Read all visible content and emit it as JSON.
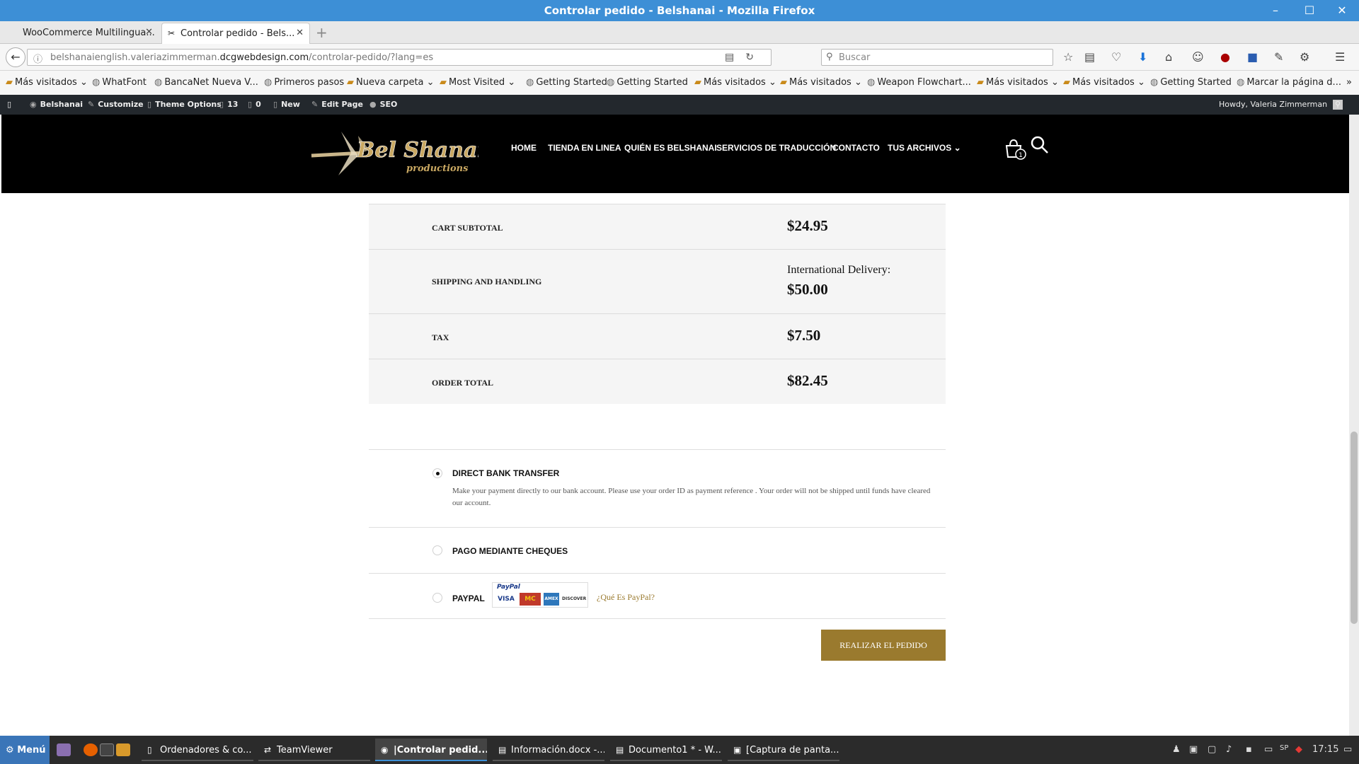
{
  "window": {
    "title": "Controlar pedido - Belshanai - Mozilla Firefox",
    "controls": [
      "–",
      "☐",
      "✕"
    ]
  },
  "tabs": [
    {
      "label": "WooCommerce Multilingua...",
      "active": false
    },
    {
      "label": "Controlar pedido - Bels...",
      "active": true
    }
  ],
  "url": {
    "prefix": "belshanaienglish.valeriazimmerman.",
    "host": "dcgwebdesign.com",
    "path": "/controlar-pedido/?lang=es"
  },
  "search": {
    "placeholder": "Buscar"
  },
  "bookmarks": [
    {
      "label": "Más visitados",
      "icon": "folder-icon",
      "dropdown": true
    },
    {
      "label": "WhatFont",
      "icon": "globe-icon",
      "dropdown": false
    },
    {
      "label": "BancaNet Nueva V...",
      "icon": "globe-icon",
      "dropdown": false
    },
    {
      "label": "Primeros pasos",
      "icon": "globe-icon",
      "dropdown": false
    },
    {
      "label": "Nueva carpeta",
      "icon": "folder-icon",
      "dropdown": true
    },
    {
      "label": "Most Visited",
      "icon": "folder-icon",
      "dropdown": true
    },
    {
      "label": "Getting Started",
      "icon": "globe-icon",
      "dropdown": false
    },
    {
      "label": "Getting Started",
      "icon": "globe-icon",
      "dropdown": false
    },
    {
      "label": "Más visitados",
      "icon": "folder-icon",
      "dropdown": true
    },
    {
      "label": "Más visitados",
      "icon": "folder-icon",
      "dropdown": true
    },
    {
      "label": "Weapon Flowchart...",
      "icon": "globe-icon",
      "dropdown": false
    },
    {
      "label": "Más visitados",
      "icon": "folder-icon",
      "dropdown": true
    },
    {
      "label": "Más visitados",
      "icon": "folder-icon",
      "dropdown": true
    },
    {
      "label": "Getting Started",
      "icon": "globe-icon",
      "dropdown": false
    },
    {
      "label": "Marcar la página d...",
      "icon": "globe-icon",
      "dropdown": false
    }
  ],
  "admin_bar": {
    "site": "Belshanai",
    "customize": "Customize",
    "theme_options": "Theme Options",
    "updates": "13",
    "comments": "0",
    "new": "New",
    "edit_page": "Edit Page",
    "seo": "SEO",
    "howdy": "Howdy, Valeria Zimmerman"
  },
  "site": {
    "logo_text": "Bel Shanai",
    "logo_sub": "productions",
    "menu": [
      "HOME",
      "TIENDA EN LINEA",
      "QUIÉN ES BELSHANAI",
      "SERVICIOS DE TRADUCCIÓN",
      "CONTACTO",
      "TUS ARCHIVOS"
    ],
    "menu_dropdown": "⌄",
    "cart_count": "1"
  },
  "totals": {
    "subtotal_label": "CART SUBTOTAL",
    "subtotal": "$24.95",
    "shipping_label": "SHIPPING AND HANDLING",
    "shipping_method": "International Delivery:",
    "shipping": "$50.00",
    "tax_label": "TAX",
    "tax": "$7.50",
    "total_label": "ORDER TOTAL",
    "total": "$82.45"
  },
  "payment": {
    "bacs_label": "DIRECT BANK TRANSFER",
    "bacs_desc": "Make your payment directly to our bank account. Please use your order ID as payment reference . Your order will not be shipped until funds have cleared our account.",
    "cheque_label": "PAGO MEDIANTE CHEQUES",
    "paypal_label": "PAYPAL",
    "paypal_brand": "PayPal",
    "cards": [
      "VISA",
      "MC",
      "AMEX",
      "DISCOVER"
    ],
    "what_is_paypal": "¿Qué Es PayPal?",
    "selected": "bacs"
  },
  "place_order": "REALIZAR EL PEDIDO",
  "taskbar": {
    "start": "Menú",
    "tasks": [
      {
        "label": "Ordenadores & co...",
        "active": false
      },
      {
        "label": "TeamViewer",
        "active": false
      },
      {
        "label": "|Controlar pedid...",
        "active": true
      },
      {
        "label": "Información.docx -...",
        "active": false
      },
      {
        "label": "Documento1 * - W...",
        "active": false
      },
      {
        "label": "[Captura de panta...",
        "active": false
      }
    ],
    "lang": "SP",
    "clock": "17:15"
  },
  "colors": {
    "titlebar": "#3d8fd6",
    "accent_gold": "#9a7a2e",
    "admin_bar": "#23282d",
    "taskbar": "#2b2b2b",
    "start": "#3a75b8"
  }
}
